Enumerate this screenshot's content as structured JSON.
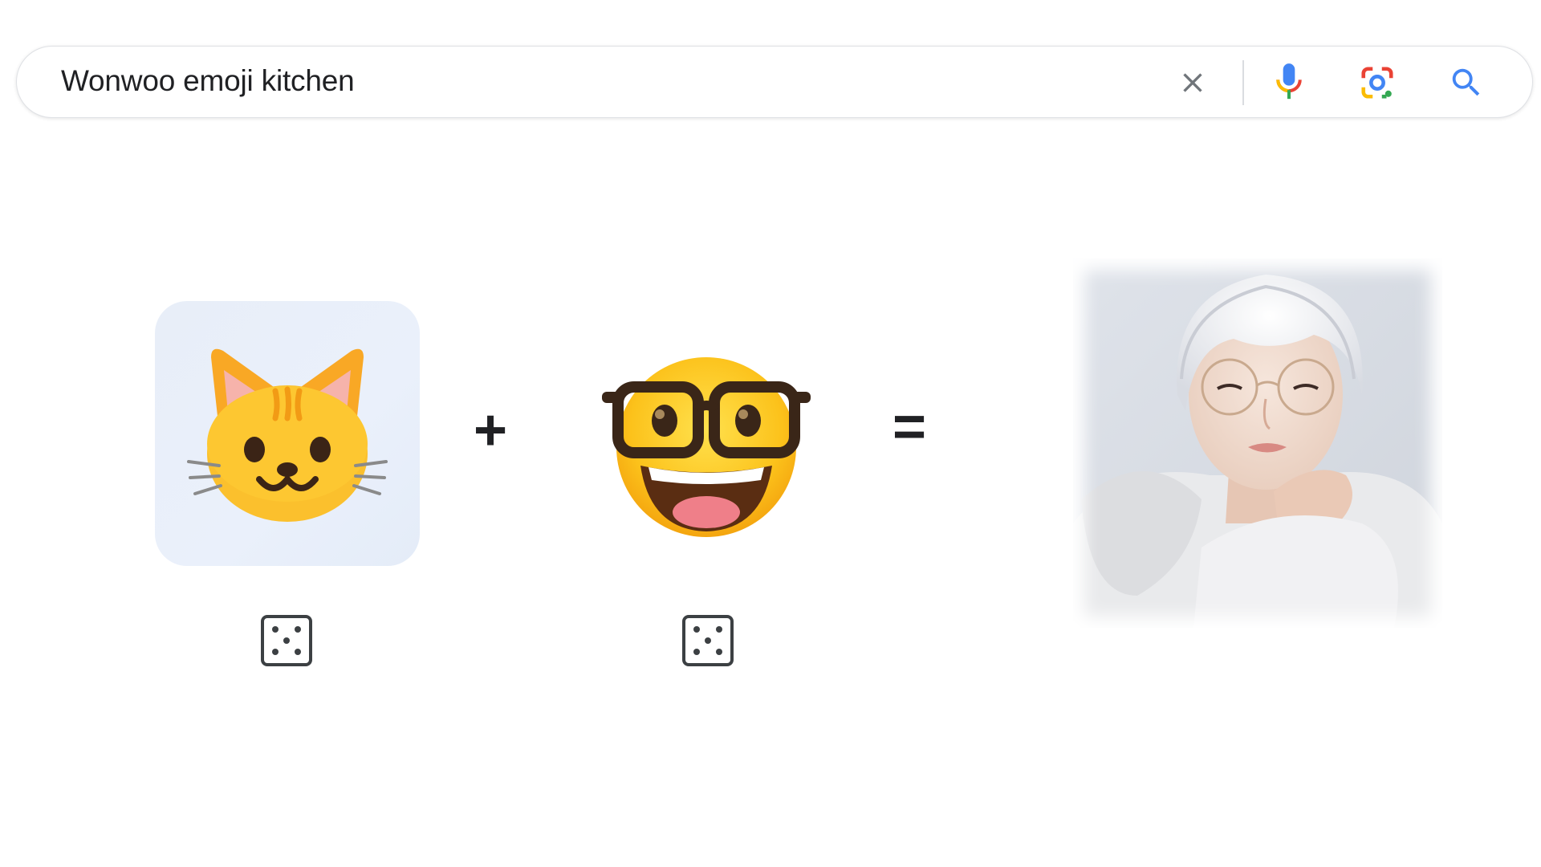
{
  "search": {
    "query": "Wonwoo emoji kitchen",
    "icons": {
      "clear": "close-icon",
      "voice": "microphone-icon",
      "lens": "google-lens-icon",
      "search": "search-icon"
    }
  },
  "kitchen": {
    "left_emoji": "cat-face-emoji",
    "right_emoji": "nerd-face-emoji",
    "plus": "+",
    "equals": "=",
    "randomize_icon": "dice-icon",
    "result": "wonwoo-photo"
  },
  "colors": {
    "google_blue": "#4285f4",
    "google_red": "#ea4335",
    "google_yellow": "#fbbc04",
    "google_green": "#34a853",
    "card_bg": "#e8eef8"
  }
}
